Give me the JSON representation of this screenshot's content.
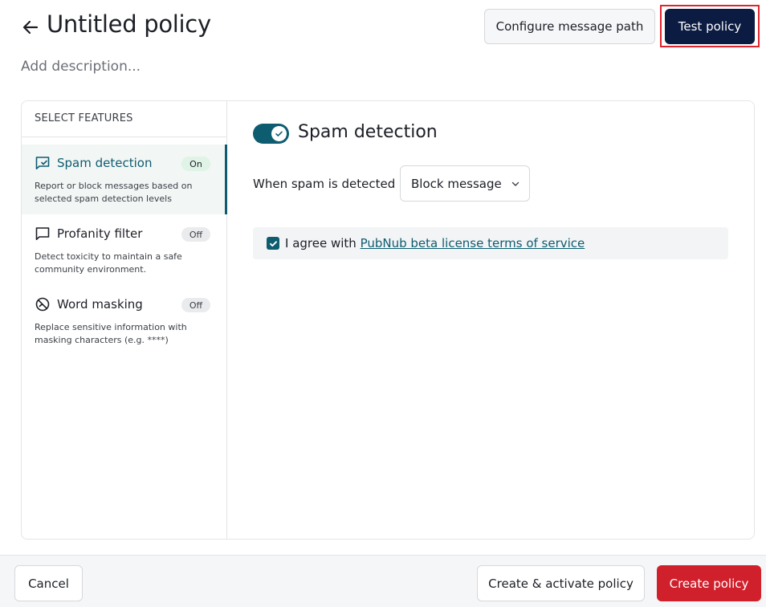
{
  "header": {
    "title": "Untitled policy",
    "description_placeholder": "Add description...",
    "configure_button": "Configure message path",
    "test_button": "Test policy"
  },
  "sidebar": {
    "heading": "SELECT FEATURES",
    "items": [
      {
        "label": "Spam detection",
        "badge": "On",
        "description": "Report or block messages based on selected spam detection levels",
        "icon": "message-check-icon",
        "active": true
      },
      {
        "label": "Profanity filter",
        "badge": "Off",
        "description": "Detect toxicity to maintain a safe community environment.",
        "icon": "message-square-icon",
        "active": false
      },
      {
        "label": "Word masking",
        "badge": "Off",
        "description": "Replace sensitive information with masking characters (e.g. ****)",
        "icon": "eye-off-icon",
        "active": false
      }
    ]
  },
  "detail": {
    "title": "Spam detection",
    "toggle_on": true,
    "field_label": "When spam is detected",
    "select_value": "Block message",
    "agree_prefix": "I agree with ",
    "agree_link": "PubNub beta license terms of service",
    "agree_checked": true
  },
  "footer": {
    "cancel": "Cancel",
    "create_activate": "Create & activate policy",
    "create": "Create policy"
  },
  "colors": {
    "primary_teal": "#0e5c70",
    "navy_button": "#0b1b41",
    "danger_red": "#d0202c",
    "highlight_outline": "#e0242e"
  }
}
